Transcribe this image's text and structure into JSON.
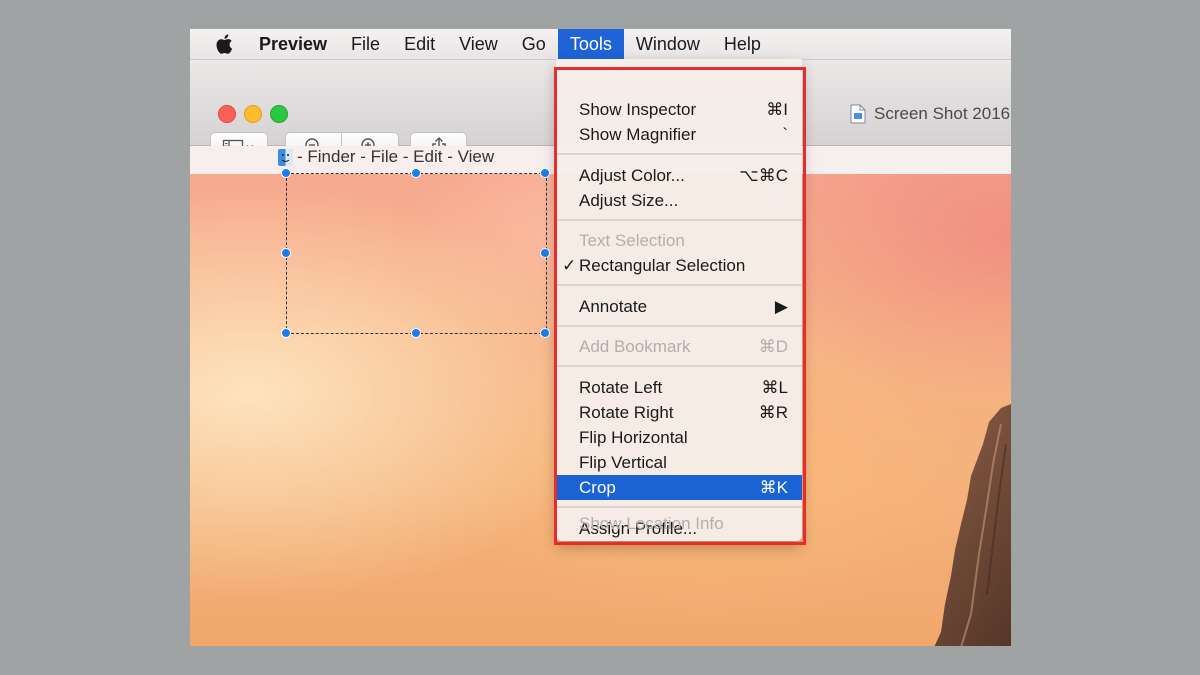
{
  "menubar": {
    "app_name": "Preview",
    "items": [
      "File",
      "Edit",
      "View",
      "Go",
      "Tools",
      "Window",
      "Help"
    ]
  },
  "window": {
    "title": "Screen Shot 2016"
  },
  "image_content": {
    "finder_strip": "- Finder - File - Edit - View"
  },
  "tools_menu": {
    "items": [
      {
        "label": "Show Inspector",
        "shortcut": "⌘I"
      },
      {
        "label": "Show Magnifier",
        "shortcut": "`"
      },
      {
        "label": "Adjust Color...",
        "shortcut": "⌥⌘C"
      },
      {
        "label": "Adjust Size...",
        "shortcut": ""
      },
      {
        "label": "Text Selection",
        "shortcut": ""
      },
      {
        "label": "Rectangular Selection",
        "shortcut": "",
        "check": "✓"
      },
      {
        "label": "Annotate",
        "shortcut": "▶"
      },
      {
        "label": "Add Bookmark",
        "shortcut": "⌘D"
      },
      {
        "label": "Rotate Left",
        "shortcut": "⌘L"
      },
      {
        "label": "Rotate Right",
        "shortcut": "⌘R"
      },
      {
        "label": "Flip Horizontal",
        "shortcut": ""
      },
      {
        "label": "Flip Vertical",
        "shortcut": ""
      },
      {
        "label": "Crop",
        "shortcut": "⌘K"
      },
      {
        "label": "Assign Profile...",
        "shortcut": ""
      },
      {
        "label": "Show Location Info",
        "shortcut": ""
      }
    ]
  },
  "colors": {
    "menu_highlight": "#1f63d6",
    "annotation_box": "#e52d2d",
    "selection_handle": "#1b7cf2"
  }
}
